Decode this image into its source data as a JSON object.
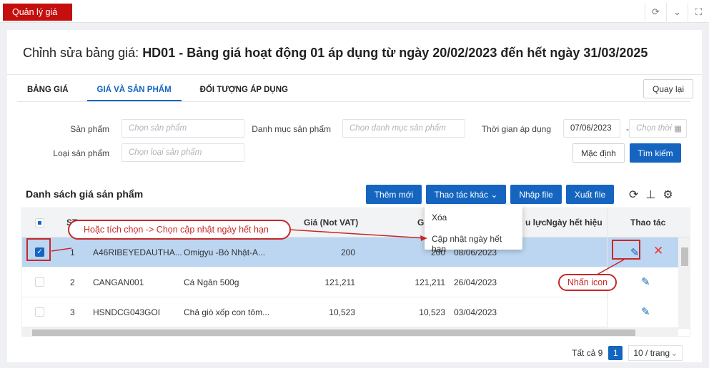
{
  "app_tab": "Quản lý giá",
  "page": {
    "title_prefix": "Chỉnh sửa bảng giá:",
    "title_main": "HD01 - Bảng giá hoạt động 01 áp dụng từ ngày 20/02/2023 đến hết ngày 31/03/2025"
  },
  "tabs": [
    "BẢNG GIÁ",
    "GIÁ VÀ SẢN PHẨM",
    "ĐỐI TƯỢNG ÁP DỤNG"
  ],
  "active_tab": "GIÁ VÀ SẢN PHẨM",
  "back_button": "Quay lại",
  "filters": {
    "product_label": "Sản phẩm",
    "product_placeholder": "Chọn sản phẩm",
    "category_label": "Danh mục sản phẩm",
    "category_placeholder": "Chọn danh mục sản phẩm",
    "time_label": "Thời gian áp dụng",
    "date_from": "07/06/2023",
    "date_sep": "-",
    "date_to_placeholder": "Chọn thời",
    "type_label": "Loại sản phẩm",
    "type_placeholder": "Chọn loại sản phẩm",
    "default_button": "Mặc định",
    "search_button": "Tìm kiếm"
  },
  "list": {
    "title": "Danh sách giá sản phẩm",
    "add_button": "Thêm mới",
    "more_button": "Thao tác khác",
    "import_button": "Nhập file",
    "export_button": "Xuất file"
  },
  "dropdown": [
    "Xóa",
    "Cập nhật ngày hết hạn"
  ],
  "table": {
    "headers": {
      "stt": "ST",
      "price": "Giá (Not VAT)",
      "price_vat": "Giá",
      "effective": "u lực",
      "expiry": "Ngày hết hiệu",
      "actions": "Thao tác"
    },
    "rows": [
      {
        "stt": "1",
        "code": "A46RIBEYEDAUTHA...",
        "name": "Omigyu -Bò Nhật-A...",
        "price": "200",
        "price_vat": "200",
        "date": "08/06/2023",
        "selected": true
      },
      {
        "stt": "2",
        "code": "CANGAN001",
        "name": "Cá Ngân 500g",
        "price": "121,211",
        "price_vat": "121,211",
        "date": "26/04/2023",
        "selected": false
      },
      {
        "stt": "3",
        "code": "HSNDCG043GOI",
        "name": "Chả giò xốp con tôm...",
        "price": "10,523",
        "price_vat": "10,523",
        "date": "03/04/2023",
        "selected": false
      }
    ]
  },
  "annotations": {
    "callout1": "Hoặc tích chọn -> Chọn cập nhật ngày hết hạn",
    "callout2": "Nhấn icon"
  },
  "pagination": {
    "total": "Tất cả 9",
    "page": "1",
    "per_page": "10 / trang"
  },
  "colors": {
    "brand_red": "#c50f0f",
    "primary": "#1565c0",
    "selected_row": "#bcd6f1",
    "annotation": "#c62828"
  }
}
